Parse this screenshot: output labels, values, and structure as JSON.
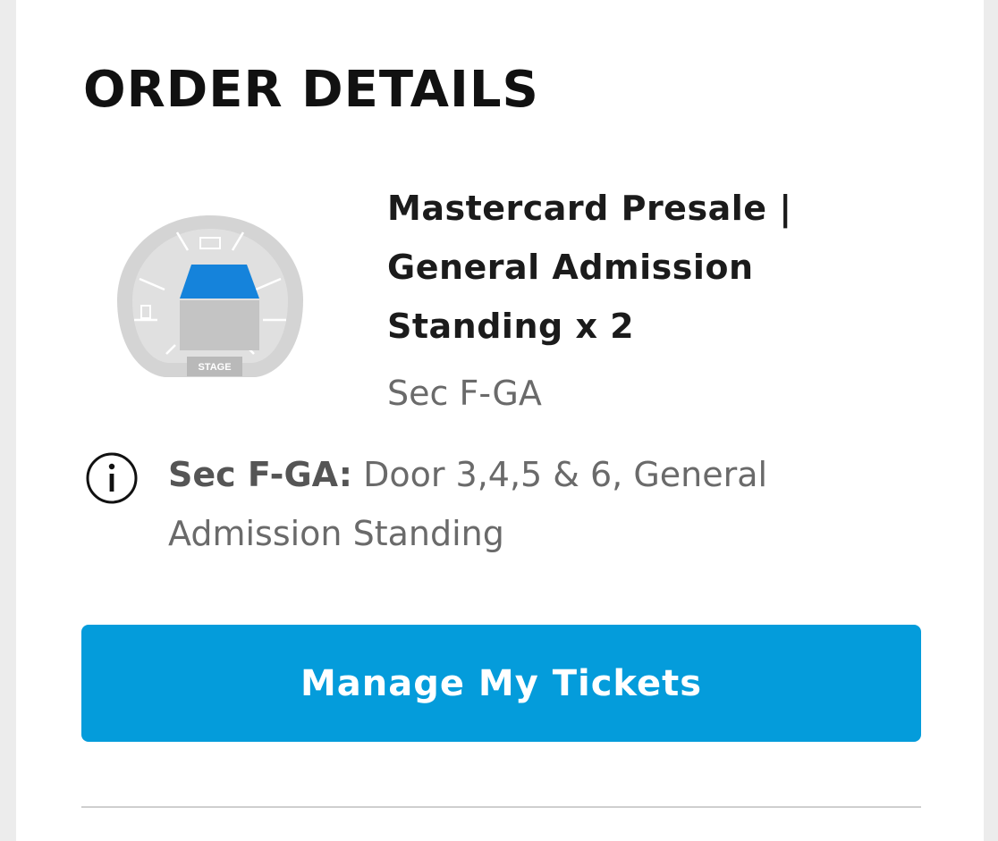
{
  "order": {
    "heading": "ORDER DETAILS",
    "ticket_name": "Mastercard Presale | General Admission Standing x 2",
    "section": "Sec F-GA",
    "info_label": "Sec F-GA:",
    "info_text": "Door 3,4,5 & 6, General Admission Standing"
  },
  "seat_map": {
    "stage_label": "STAGE",
    "highlight_color": "#1583db",
    "base_color": "#d4d4d4"
  },
  "actions": {
    "manage_label": "Manage My Tickets",
    "button_color": "#049cdb"
  },
  "icons": {
    "info": "info-icon"
  }
}
